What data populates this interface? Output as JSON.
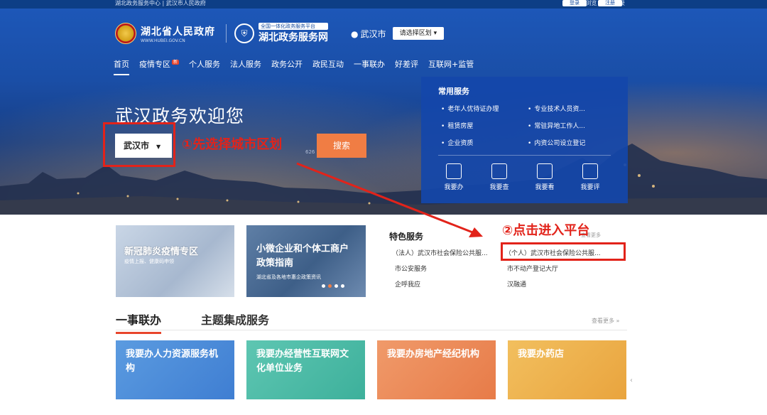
{
  "topbar": {
    "left": "湖北政务服务中心  |  武汉市人民政府",
    "right": "无障碍浏览  ·  扫码登录",
    "login": "登录",
    "register": "注册"
  },
  "header": {
    "gov_name": "湖北省人民政府",
    "gov_sub": "WWW.HUBEI.GOV.CN",
    "platform_tag": "全国一体化政务服务平台",
    "platform_name": "湖北政务服务网",
    "city": "武汉市",
    "region_button": "请选择区划"
  },
  "nav": {
    "items": [
      "首页",
      "疫情专区",
      "个人服务",
      "法人服务",
      "政务公开",
      "政民互动",
      "一事联办",
      "好差评",
      "互联网+监管"
    ],
    "new_badge": "新"
  },
  "hero": {
    "welcome": "武汉政务欢迎您",
    "city_select": "武汉市",
    "search_hint": "626",
    "search_button": "搜索",
    "annotation_1": "①先选择城市区划"
  },
  "services": {
    "title": "常用服务",
    "items": [
      "老年人优待证办理",
      "专业技术人员资...",
      "租赁房屋",
      "常驻异地工作人...",
      "企业资质",
      "内资公司设立登记"
    ],
    "tools": [
      "我要办",
      "我要查",
      "我要看",
      "我要评"
    ]
  },
  "cards": {
    "c1_title": "新冠肺炎疫情专区",
    "c1_sub": "疫情上报、健康码申领",
    "c2_title": "小微企业和个体工商户政策指南",
    "c2_sub": "湖北省及各地市惠企政策资讯"
  },
  "featured": {
    "title": "特色服务",
    "more": "查看更多",
    "items": [
      "（法人）武汉市社会保险公共服...",
      "（个人）武汉市社会保险公共服...",
      "市公安服务",
      "市不动产登记大厅",
      "企呼我应",
      "汉融通"
    ],
    "annotation_2": "②点击进入平台"
  },
  "tabs": {
    "active": "一事联办",
    "inactive": "主题集成服务",
    "more": "查看更多 »"
  },
  "tiles": [
    "我要办人力资源服务机构",
    "我要办经营性互联网文化单位业务",
    "我要办房地产经纪机构",
    "我要办药店"
  ],
  "colors": {
    "accent_red": "#e2231a",
    "search_orange": "#f07d44",
    "services_blue": "#1446aa"
  }
}
